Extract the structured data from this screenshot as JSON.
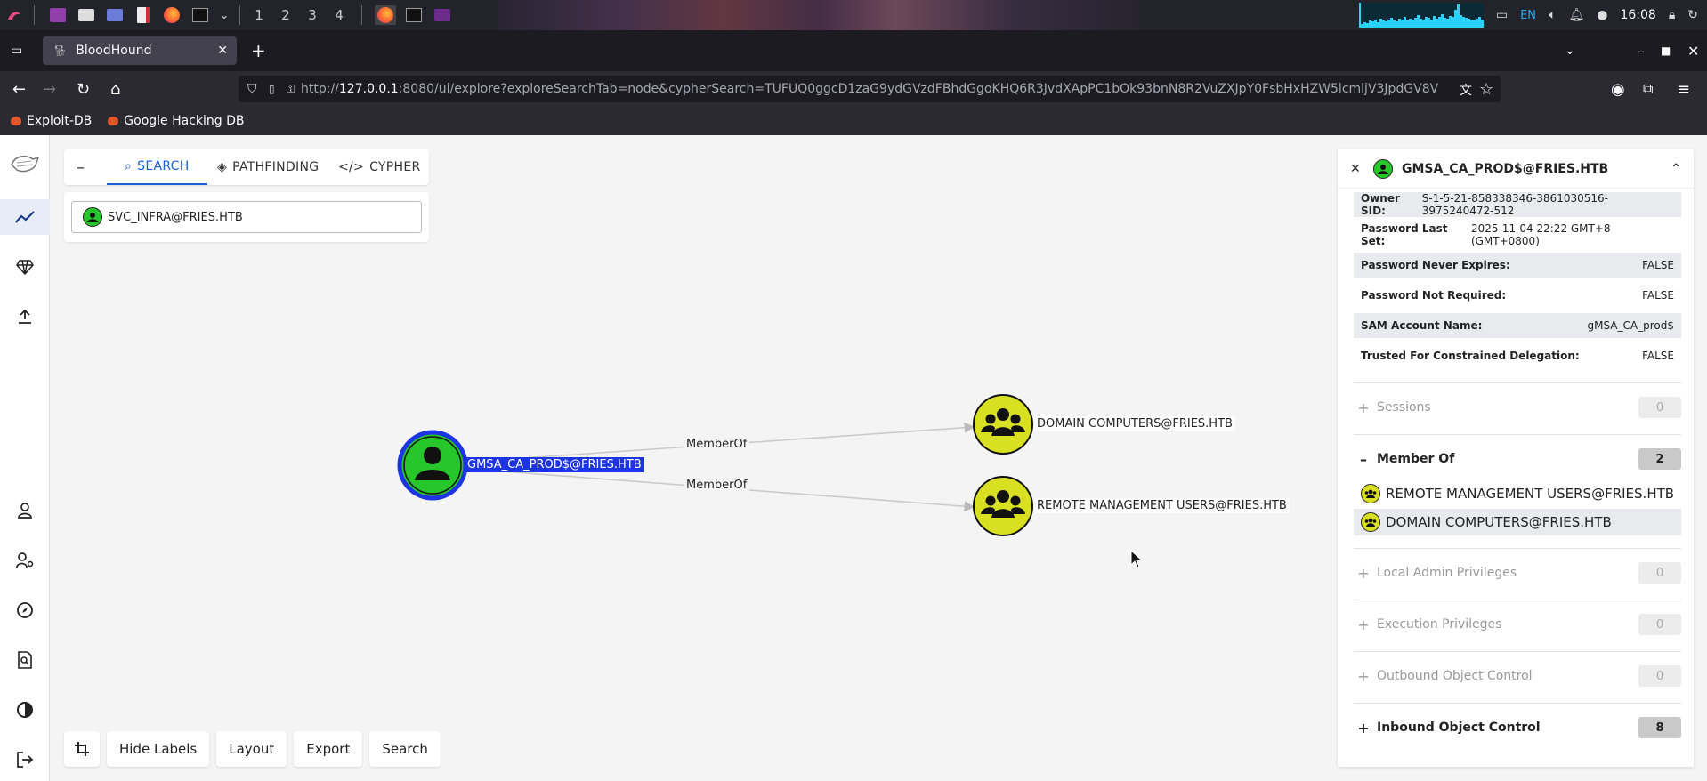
{
  "taskbar": {
    "workspaces": [
      "1",
      "2",
      "3",
      "4"
    ],
    "lang": "EN",
    "clock": "16:08"
  },
  "browser": {
    "tab_title": "BloodHound",
    "url_prefix": "http://",
    "url_host": "127.0.0.1",
    "url_rest": ":8080/ui/explore?exploreSearchTab=node&cypherSearch=TUFUQ0ggcD1zaG9ydGVzdFBhdGgoKHQ6R3JvdXApPC1bOk93bnN8R2VuZXJpY0FsbHxHZW5lcmljV3JpdGV8V",
    "bookmarks": [
      "Exploit-DB",
      "Google Hacking DB"
    ]
  },
  "search": {
    "tabs": [
      "SEARCH",
      "PATHFINDING",
      "CYPHER"
    ],
    "selected_node": "SVC_INFRA@FRIES.HTB"
  },
  "graph": {
    "source": "GMSA_CA_PROD$@FRIES.HTB",
    "target1": "DOMAIN COMPUTERS@FRIES.HTB",
    "target2": "REMOTE MANAGEMENT USERS@FRIES.HTB",
    "edge1": "MemberOf",
    "edge2": "MemberOf"
  },
  "toolbar": {
    "hide_labels": "Hide Labels",
    "layout": "Layout",
    "export": "Export",
    "search": "Search"
  },
  "panel": {
    "title": "GMSA_CA_PROD$@FRIES.HTB",
    "properties": [
      {
        "k": "Owner SID:",
        "v": "S-1-5-21-858338346-3861030516-3975240472-512"
      },
      {
        "k": "Password Last Set:",
        "v": "2025-11-04 22:22 GMT+8 (GMT+0800)"
      },
      {
        "k": "Password Never Expires:",
        "v": "FALSE"
      },
      {
        "k": "Password Not Required:",
        "v": "FALSE"
      },
      {
        "k": "SAM Account Name:",
        "v": "gMSA_CA_prod$"
      },
      {
        "k": "Trusted For Constrained Delegation:",
        "v": "FALSE"
      }
    ],
    "sections": {
      "sessions": {
        "title": "Sessions",
        "count": "0"
      },
      "member_of": {
        "title": "Member Of",
        "count": "2"
      },
      "local_admin": {
        "title": "Local Admin Privileges",
        "count": "0"
      },
      "execution": {
        "title": "Execution Privileges",
        "count": "0"
      },
      "outbound": {
        "title": "Outbound Object Control",
        "count": "0"
      },
      "inbound": {
        "title": "Inbound Object Control",
        "count": "8"
      }
    },
    "member_of_items": [
      "REMOTE MANAGEMENT USERS@FRIES.HTB",
      "DOMAIN COMPUTERS@FRIES.HTB"
    ]
  }
}
